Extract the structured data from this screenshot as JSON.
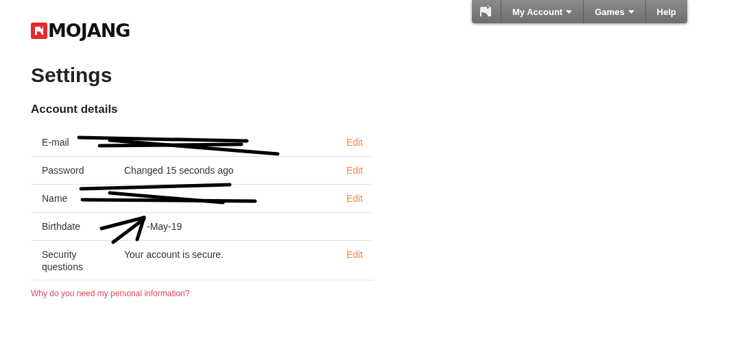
{
  "nav": {
    "items": [
      {
        "kind": "icon"
      },
      {
        "kind": "menu",
        "label": "My Account"
      },
      {
        "kind": "menu",
        "label": "Games"
      },
      {
        "kind": "link",
        "label": "Help"
      }
    ]
  },
  "logo": {
    "text": "MOJANG"
  },
  "title": "Settings",
  "section": "Account details",
  "rows": [
    {
      "label": "E-mail",
      "action": "Edit"
    },
    {
      "label": "Password",
      "value": "Changed 15 seconds ago",
      "action": "Edit"
    },
    {
      "label": "Name",
      "action": "Edit"
    },
    {
      "label": "Birthdate",
      "value": "-May-19"
    },
    {
      "label": "Security questions",
      "value": "Your account is secure.",
      "action": "Edit"
    }
  ],
  "footer_link": "Why do you need my personal information?"
}
